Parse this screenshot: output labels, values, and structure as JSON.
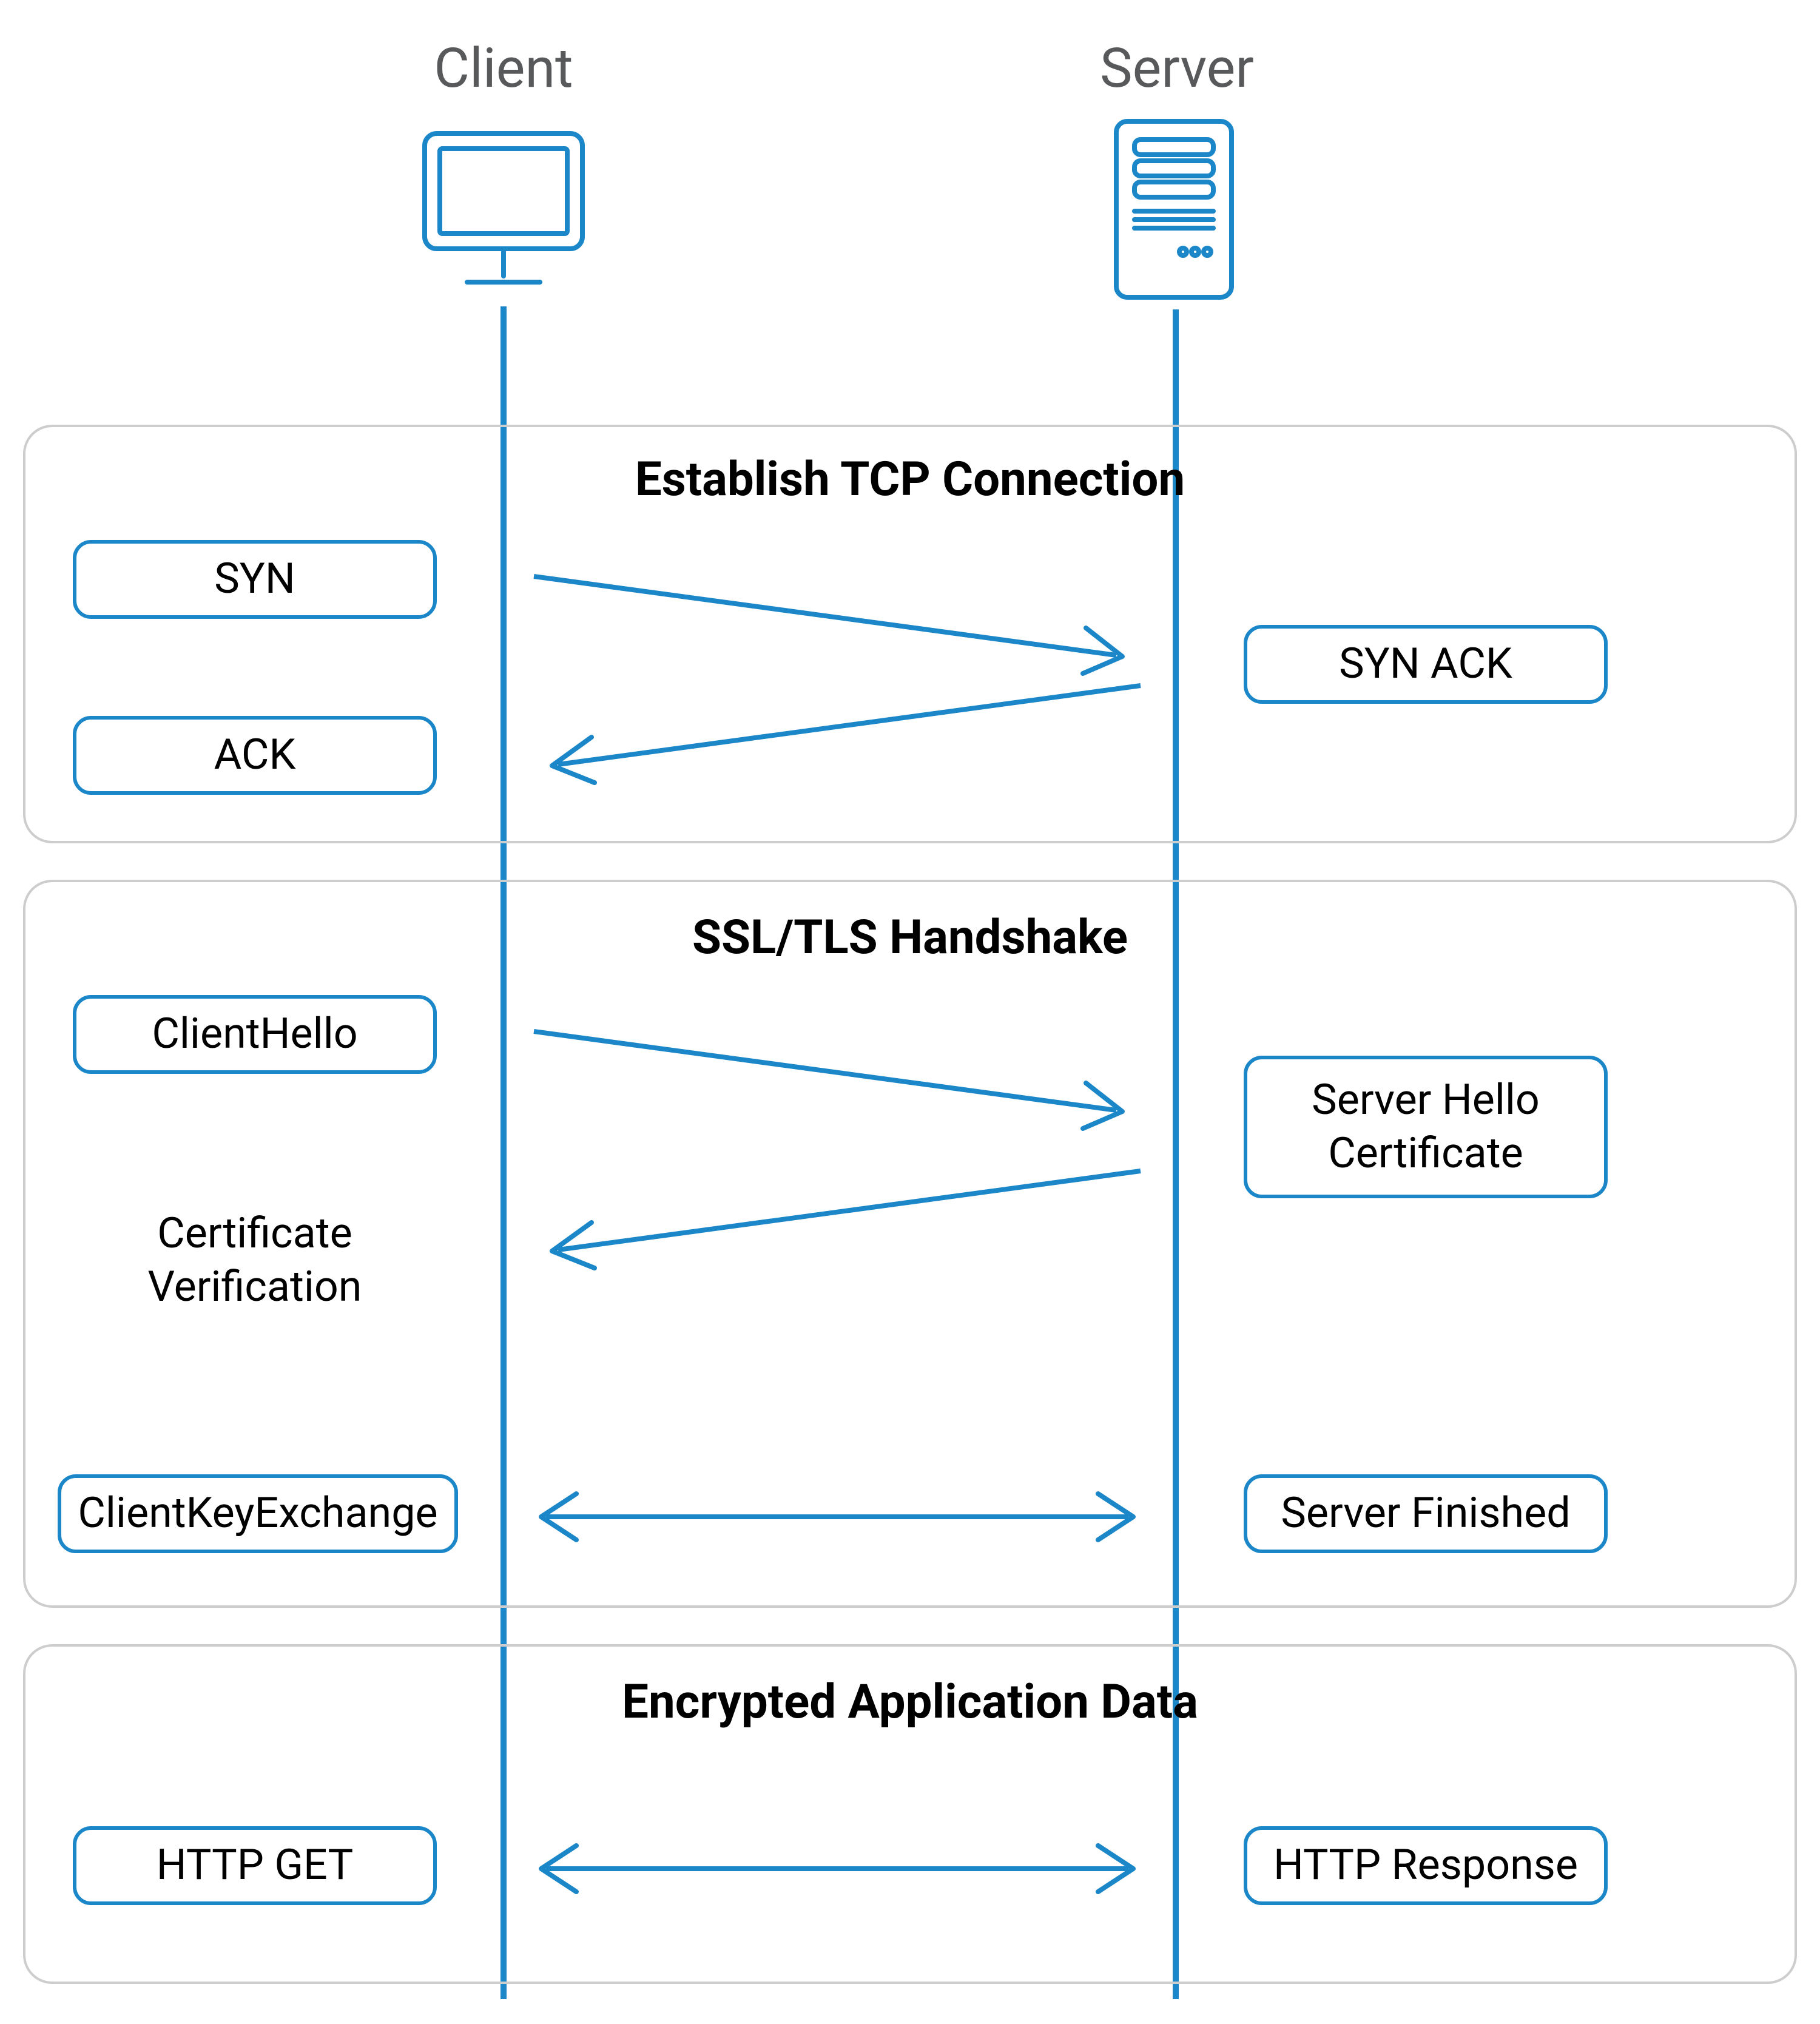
{
  "colors": {
    "accent": "#1b87c9",
    "panel_border": "#cdcdcd",
    "header_text": "#58595b",
    "body_text": "#000000"
  },
  "actors": {
    "client_label": "Client",
    "server_label": "Server",
    "client_icon_name": "monitor-icon",
    "server_icon_name": "server-rack-icon"
  },
  "phases": [
    {
      "id": "tcp",
      "title": "Establish TCP Connection",
      "messages": [
        {
          "side": "client",
          "label": "SYN",
          "boxed": true
        },
        {
          "side": "server",
          "label": "SYN ACK",
          "boxed": true
        },
        {
          "side": "client",
          "label": "ACK",
          "boxed": true
        }
      ],
      "arrows": [
        {
          "dir": "right",
          "kind": "diagonal"
        },
        {
          "dir": "left",
          "kind": "diagonal"
        }
      ]
    },
    {
      "id": "tls",
      "title": "SSL/TLS Handshake",
      "messages": [
        {
          "side": "client",
          "label": "ClientHello",
          "boxed": true
        },
        {
          "side": "server",
          "label": "Server Hello\nCertificate",
          "boxed": true
        },
        {
          "side": "client",
          "label": "Certificate\nVerification",
          "boxed": false
        },
        {
          "side": "client",
          "label": "ClientKeyExchange",
          "boxed": true
        },
        {
          "side": "server",
          "label": "Server Finished",
          "boxed": true
        }
      ],
      "arrows": [
        {
          "dir": "right",
          "kind": "diagonal"
        },
        {
          "dir": "left",
          "kind": "diagonal"
        },
        {
          "dir": "both",
          "kind": "horizontal"
        }
      ]
    },
    {
      "id": "data",
      "title": "Encrypted Application Data",
      "messages": [
        {
          "side": "client",
          "label": "HTTP GET",
          "boxed": true
        },
        {
          "side": "server",
          "label": "HTTP Response",
          "boxed": true
        }
      ],
      "arrows": [
        {
          "dir": "both",
          "kind": "horizontal"
        }
      ]
    }
  ]
}
